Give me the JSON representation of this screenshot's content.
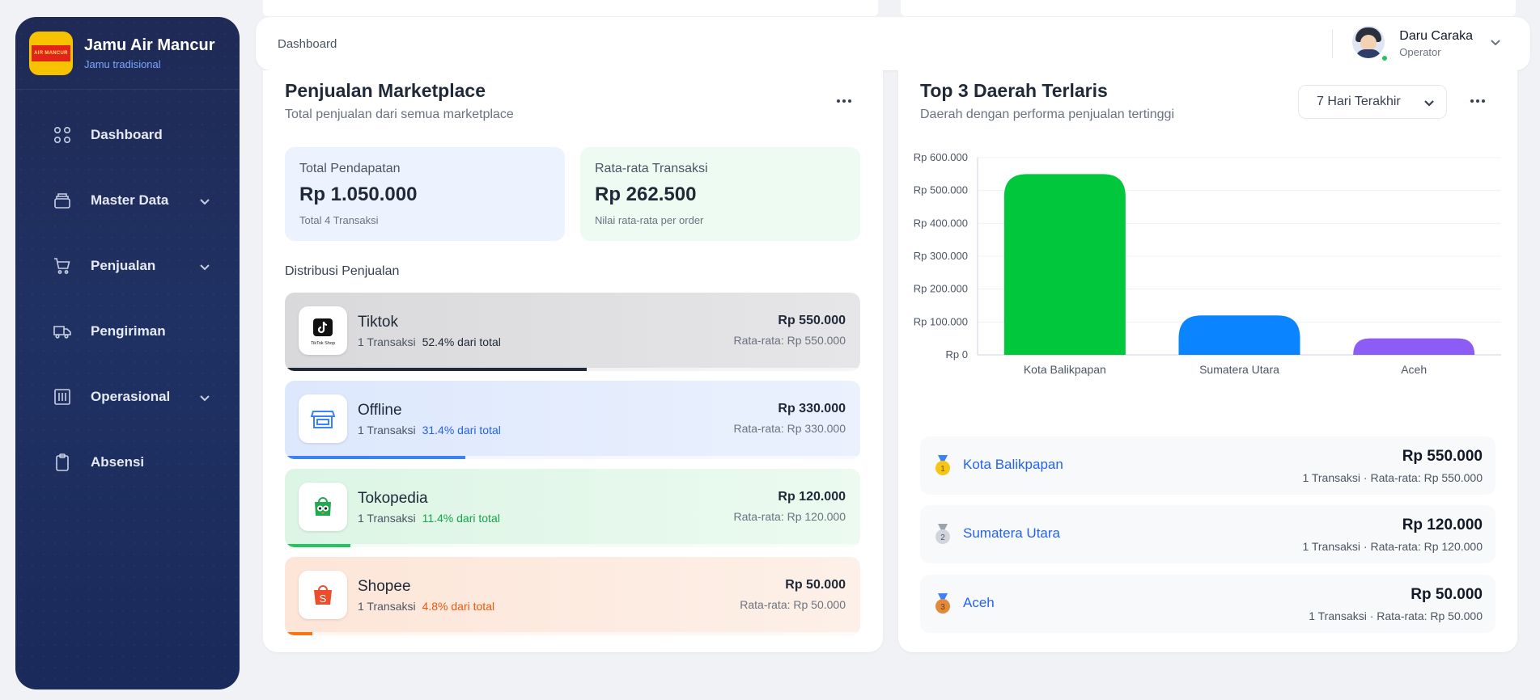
{
  "brand": {
    "title": "Jamu Air Mancur",
    "subtitle": "Jamu tradisional",
    "logo_text": "AIR MANCUR"
  },
  "sidebar": {
    "items": [
      {
        "label": "Dashboard",
        "icon": "grid-icon",
        "has_submenu": false
      },
      {
        "label": "Master Data",
        "icon": "database-icon",
        "has_submenu": true
      },
      {
        "label": "Penjualan",
        "icon": "cart-icon",
        "has_submenu": true
      },
      {
        "label": "Pengiriman",
        "icon": "truck-icon",
        "has_submenu": false
      },
      {
        "label": "Operasional",
        "icon": "building-icon",
        "has_submenu": true
      },
      {
        "label": "Absensi",
        "icon": "clipboard-icon",
        "has_submenu": false
      }
    ]
  },
  "header": {
    "breadcrumb": "Dashboard",
    "user_name": "Daru Caraka",
    "user_role": "Operator",
    "online": true
  },
  "marketplace": {
    "title": "Penjualan Marketplace",
    "subtitle": "Total penjualan dari semua marketplace",
    "stats": [
      {
        "label": "Total Pendapatan",
        "value": "Rp 1.050.000",
        "note": "Total 4 Transaksi",
        "bg": "#edf3fe"
      },
      {
        "label": "Rata-rata Transaksi",
        "value": "Rp 262.500",
        "note": "Nilai rata-rata per order",
        "bg": "#edfbf2"
      }
    ],
    "distribution_title": "Distribusi Penjualan",
    "items": [
      {
        "name": "Tiktok",
        "transactions": "1 Transaksi",
        "percent_text": "52.4% dari total",
        "percent": 52.4,
        "amount": "Rp 550.000",
        "avg": "Rata-rata: Rp 550.000",
        "icon": "tiktok-shop-icon",
        "icon_caption": "TikTok Shop",
        "accent": "#1f2937",
        "pct_color": "#1f2937",
        "bg": "linear-gradient(90deg,#d9d9db,#e6e6e8)"
      },
      {
        "name": "Offline",
        "transactions": "1 Transaksi",
        "percent_text": "31.4% dari total",
        "percent": 31.4,
        "amount": "Rp 330.000",
        "avg": "Rata-rata: Rp 330.000",
        "icon": "store-icon",
        "accent": "#3b82f6",
        "pct_color": "#2563eb",
        "bg": "linear-gradient(90deg,#dde8fd,#ebf1fd)"
      },
      {
        "name": "Tokopedia",
        "transactions": "1 Transaksi",
        "percent_text": "11.4% dari total",
        "percent": 11.4,
        "amount": "Rp 120.000",
        "avg": "Rata-rata: Rp 120.000",
        "icon": "tokopedia-icon",
        "accent": "#22c55e",
        "pct_color": "#16a34a",
        "bg": "linear-gradient(90deg,#dcf5e4,#ecfaf0)"
      },
      {
        "name": "Shopee",
        "transactions": "1 Transaksi",
        "percent_text": "4.8% dari total",
        "percent": 4.8,
        "amount": "Rp 50.000",
        "avg": "Rata-rata: Rp 50.000",
        "icon": "shopee-icon",
        "accent": "#f97316",
        "pct_color": "#ea580c",
        "bg": "linear-gradient(90deg,#fde5d8,#fdf0e8)"
      }
    ]
  },
  "regions": {
    "title": "Top 3 Daerah Terlaris",
    "subtitle": "Daerah dengan performa penjualan tertinggi",
    "period": "7 Hari Terakhir",
    "ranking": [
      {
        "rank": "1",
        "name": "Kota Balikpapan",
        "amount": "Rp 550.000",
        "meta": "1 Transaksi  ·  Rata-rata: Rp 550.000",
        "medal": "gold-medal-icon"
      },
      {
        "rank": "2",
        "name": "Sumatera Utara",
        "amount": "Rp 120.000",
        "meta": "1 Transaksi  ·  Rata-rata: Rp 120.000",
        "medal": "silver-medal-icon"
      },
      {
        "rank": "3",
        "name": "Aceh",
        "amount": "Rp 50.000",
        "meta": "1 Transaksi  ·  Rata-rata: Rp 50.000",
        "medal": "bronze-medal-icon"
      }
    ]
  },
  "chart_data": {
    "type": "bar",
    "categories": [
      "Kota Balikpapan",
      "Sumatera Utara",
      "Aceh"
    ],
    "values": [
      550000,
      120000,
      50000
    ],
    "colors": [
      "#00c73c",
      "#0a84ff",
      "#8b5cf6"
    ],
    "ylim": [
      0,
      600000
    ],
    "yticks": [
      0,
      100000,
      200000,
      300000,
      400000,
      500000,
      600000
    ],
    "ytick_labels": [
      "Rp 0",
      "Rp 100.000",
      "Rp 200.000",
      "Rp 300.000",
      "Rp 400.000",
      "Rp 500.000",
      "Rp 600.000"
    ],
    "grid": true,
    "title": "",
    "xlabel": "",
    "ylabel": ""
  }
}
